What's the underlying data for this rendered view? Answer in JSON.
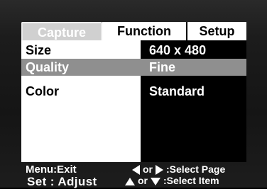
{
  "tabs": [
    {
      "label": "Capture",
      "active": true
    },
    {
      "label": "Function",
      "active": false
    },
    {
      "label": "Setup",
      "active": false
    }
  ],
  "rows": [
    {
      "label": "Size",
      "value": "640 x 480",
      "highlighted": false
    },
    {
      "label": "Quality",
      "value": "Fine",
      "highlighted": true
    },
    {
      "label": "Color",
      "value": "Standard",
      "highlighted": false
    }
  ],
  "footer": {
    "menu_exit": "Menu:Exit",
    "set_adjust": "Set : Adjust",
    "or1": "or",
    "select_page": ":Select Page",
    "or2": "or",
    "select_item": ":Select Item"
  },
  "icons": {
    "nav_left": "left-triangle-icon",
    "nav_right": "right-triangle-icon",
    "nav_up": "up-triangle-icon",
    "nav_down": "down-triangle-icon"
  },
  "colors": {
    "active_tab_bg": "#d0d0d0",
    "highlight_row": "#8f8f8f",
    "value_column_bg": "#000000",
    "label_column_bg": "#ffffff"
  }
}
